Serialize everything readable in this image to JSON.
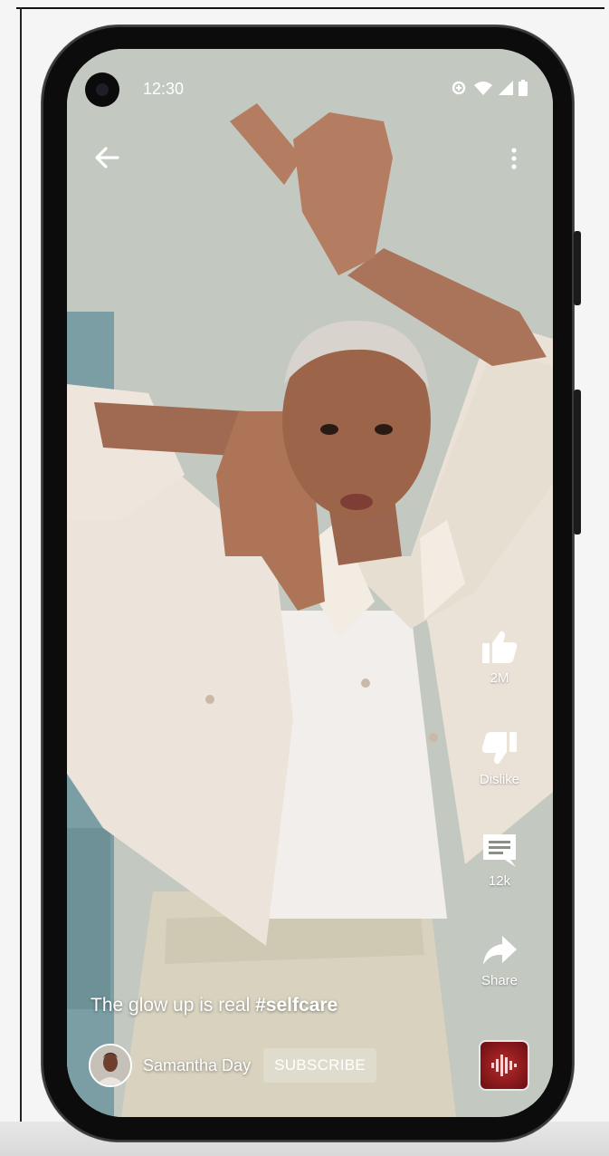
{
  "status_bar": {
    "time": "12:30"
  },
  "top_bar": {
    "back_icon": "arrow-left-icon",
    "more_icon": "more-vert-icon"
  },
  "actions": {
    "like": {
      "icon": "thumb-up-icon",
      "label": "2M"
    },
    "dislike": {
      "icon": "thumb-down-icon",
      "label": "Dislike"
    },
    "comments": {
      "icon": "comment-icon",
      "label": "12k"
    },
    "share": {
      "icon": "share-icon",
      "label": "Share"
    }
  },
  "caption": {
    "text": "The glow up is real",
    "hashtag": "#selfcare"
  },
  "channel": {
    "name": "Samantha Day",
    "subscribe_label": "SUBSCRIBE"
  },
  "sound": {
    "icon": "sound-wave-icon"
  },
  "colors": {
    "overlay_text": "#ffffff",
    "sound_tile": "#a3202a",
    "backdrop": "#c4c9c2"
  }
}
